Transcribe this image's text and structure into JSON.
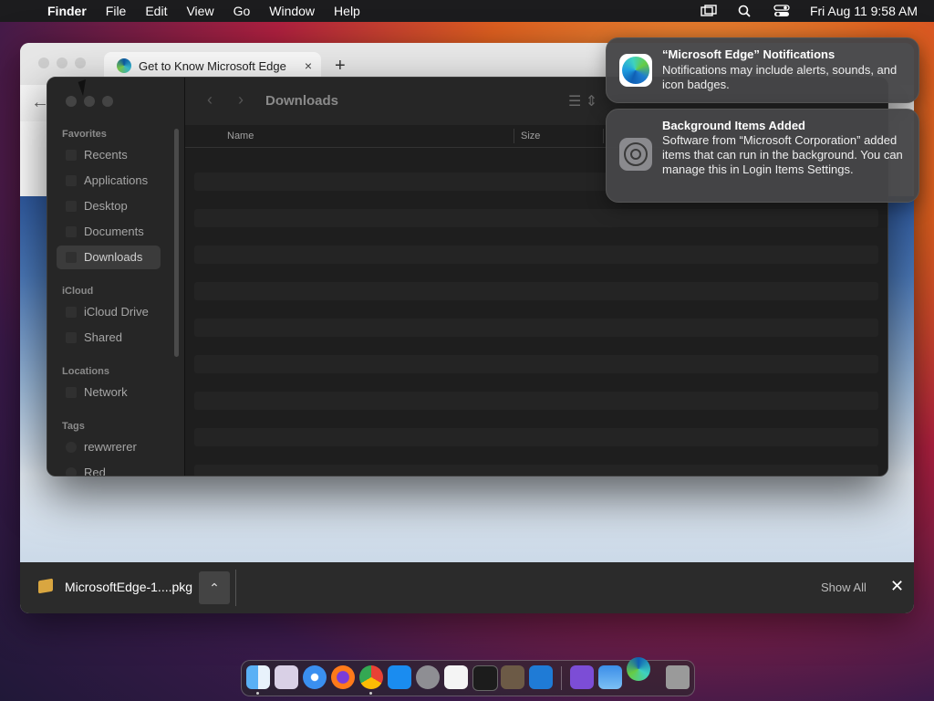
{
  "menubar": {
    "app": "Finder",
    "menus": [
      "File",
      "Edit",
      "View",
      "Go",
      "Window",
      "Help"
    ],
    "datetime": "Fri Aug 11  9:58 AM"
  },
  "edge": {
    "tab_title": "Get to Know Microsoft Edge",
    "new_tab": "+",
    "close_tab": "×",
    "download": {
      "filename": "MicrosoftEdge-1....pkg",
      "show_all": "Show All",
      "close": "✕"
    }
  },
  "finder": {
    "title": "Downloads",
    "sidebar": {
      "favorites_header": "Favorites",
      "favorites": [
        "Recents",
        "Applications",
        "Desktop",
        "Documents",
        "Downloads"
      ],
      "icloud_header": "iCloud",
      "icloud": [
        "iCloud Drive",
        "Shared"
      ],
      "locations_header": "Locations",
      "locations": [
        "Network"
      ],
      "tags_header": "Tags",
      "tags": [
        "rewwrerer",
        "Red"
      ]
    },
    "columns": {
      "name": "Name",
      "size": "Size"
    }
  },
  "notifications": [
    {
      "title": "“Microsoft Edge” Notifications",
      "body": "Notifications may include alerts, sounds, and icon badges."
    },
    {
      "title": "Background Items Added",
      "body": "Software from “Microsoft Corporation” added items that can run in the background. You can manage this in Login Items Settings."
    }
  ],
  "dock": {
    "apps": [
      "finder-icon",
      "launchpad-icon",
      "safari-icon",
      "firefox-icon",
      "chrome-icon",
      "app-store-icon",
      "system-settings-icon",
      "textedit-icon",
      "terminal-icon",
      "instruments-icon",
      "vscode-icon",
      "visual-studio-icon",
      "weather-icon",
      "edge-icon",
      "trash-icon"
    ]
  }
}
